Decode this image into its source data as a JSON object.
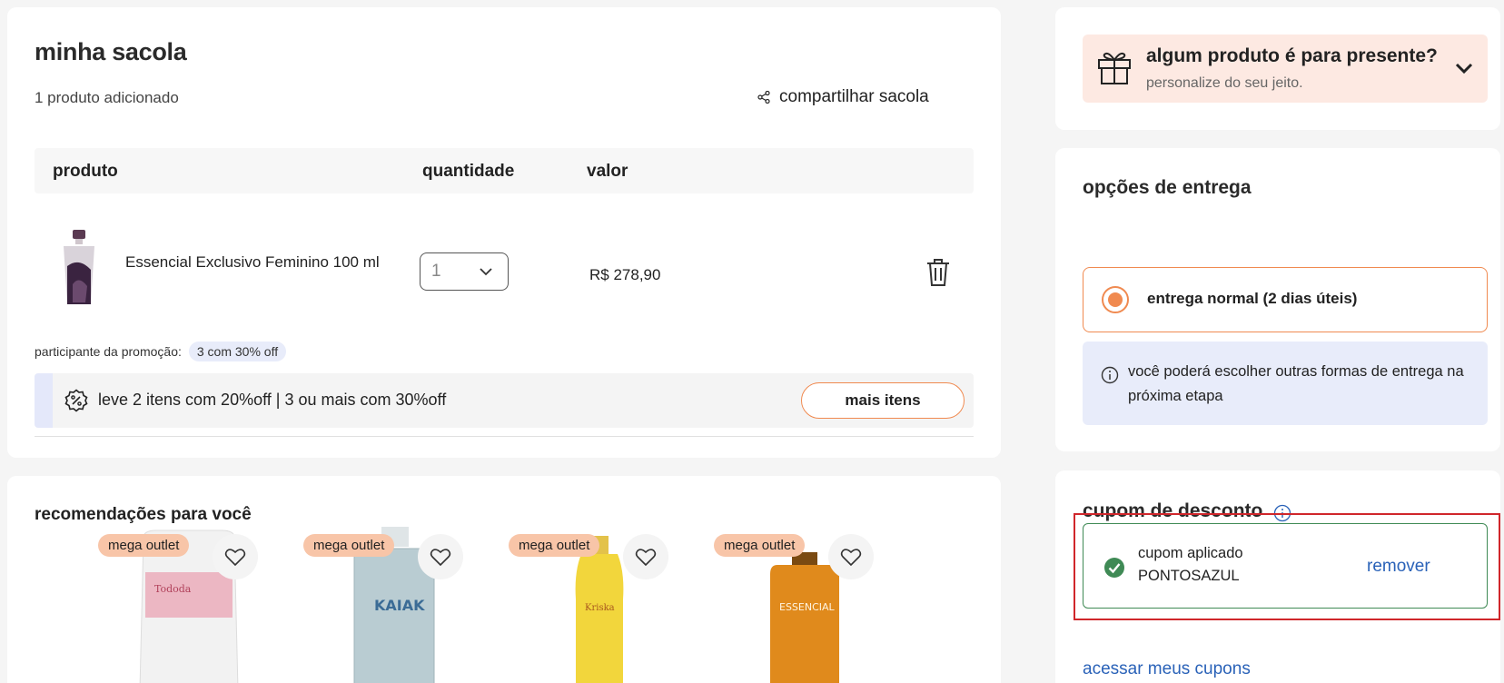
{
  "bag": {
    "title": "minha sacola",
    "count_text": "1 produto adicionado",
    "share_label": "compartilhar sacola",
    "columns": {
      "product": "produto",
      "quantity": "quantidade",
      "value": "valor"
    },
    "item": {
      "name": "Essencial Exclusivo Feminino 100 ml",
      "quantity": "1",
      "price": "R$ 278,90"
    },
    "promo_label": "participante da promoção:",
    "promo_badge": "3 com 30% off",
    "promo_bar_text": "leve 2 itens com 20%off | 3 ou mais com 30%off",
    "more_items_label": "mais itens"
  },
  "recommendations": {
    "title": "recomendações para você",
    "items": [
      {
        "badge": "mega outlet",
        "product_label": "Tododa"
      },
      {
        "badge": "mega outlet",
        "product_label": "KAIAK"
      },
      {
        "badge": "mega outlet",
        "product_label": "Kriska"
      },
      {
        "badge": "mega outlet",
        "product_label": "ESSENCIAL"
      }
    ]
  },
  "gift": {
    "title": "algum produto é para presente?",
    "subtitle": "personalize do seu jeito."
  },
  "delivery": {
    "title": "opções de entrega",
    "option_label": "entrega normal (2 dias úteis)",
    "info_text": "você poderá escolher outras formas de entrega na próxima etapa"
  },
  "coupon": {
    "title": "cupom de desconto",
    "applied_label": "cupom aplicado",
    "code": "PONTOSAZUL",
    "remove_label": "remover",
    "my_coupons_link": "acessar meus cupons"
  },
  "colors": {
    "accent": "#f08a50",
    "link": "#2a62b8",
    "success": "#3f8a55",
    "highlight": "#d0262b",
    "gift_bg": "#fde9e2",
    "info_bg": "#e8ecfa"
  }
}
